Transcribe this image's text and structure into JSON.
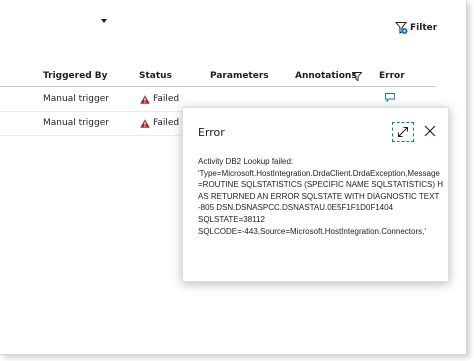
{
  "toolbar": {
    "filter_label": "Filter",
    "filter_icon": "filter-icon",
    "dropdown_icon": "caret-down-icon"
  },
  "table": {
    "columns": [
      "Triggered By",
      "Status",
      "Parameters",
      "Annotations",
      "Error"
    ],
    "annotations_filter_icon": "funnel-icon",
    "rows": [
      {
        "triggered_by": "Manual trigger",
        "status": "Failed",
        "status_icon": "warning-icon",
        "error_icon": "comment-icon"
      },
      {
        "triggered_by": "Manual trigger",
        "status": "Failed",
        "status_icon": "warning-icon"
      }
    ]
  },
  "dialog": {
    "title": "Error",
    "message": "Activity DB2 Lookup failed:\n'Type=Microsoft.HostIntegration.DrdaClient.DrdaException,Message=ROUTINE SQLSTATISTICS (SPECIFIC NAME SQLSTATISTICS) HAS RETURNED AN ERROR SQLSTATE WITH DIAGNOSTIC TEXT -805 DSN.DSNASPCC.DSNASTAU.0E5F1F1D0F1404\nSQLSTATE=38112\nSQLCODE=-443,Source=Microsoft.HostIntegration.Connectors,'",
    "expand_icon": "expand-icon",
    "close_icon": "close-icon"
  },
  "colors": {
    "accent": "#0078d4",
    "error": "#a4262c",
    "text": "#201f1e"
  }
}
